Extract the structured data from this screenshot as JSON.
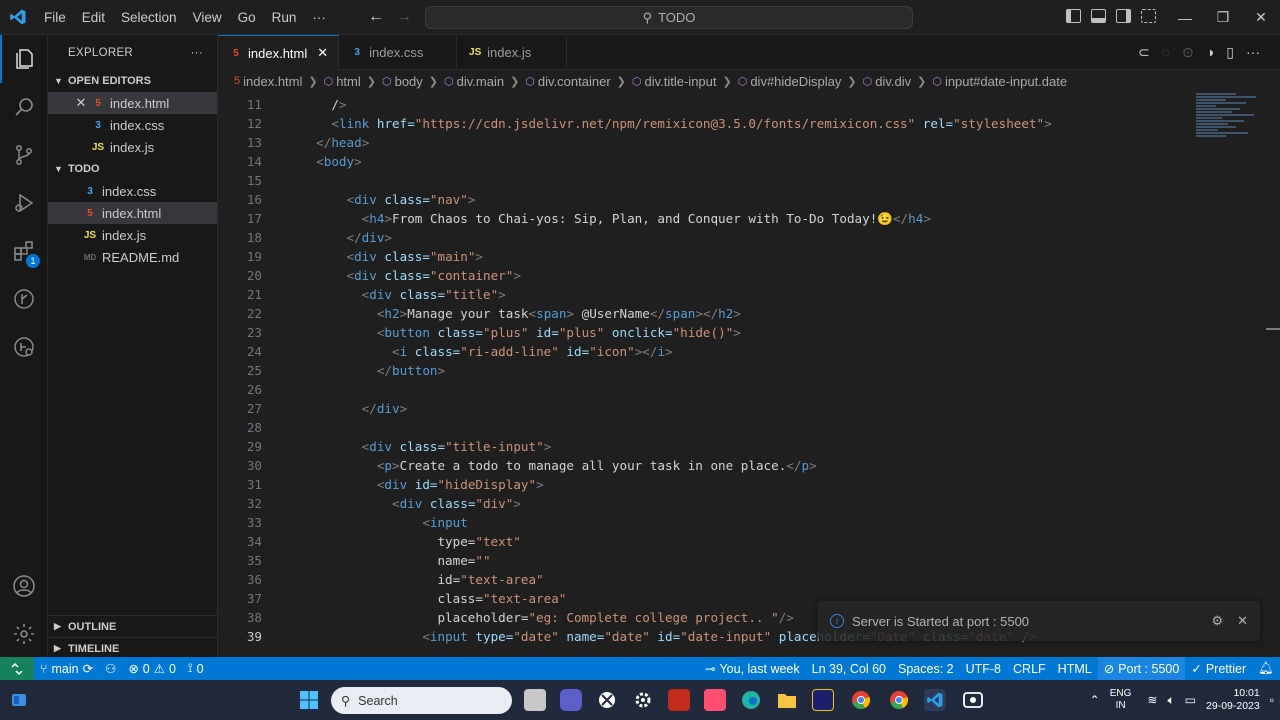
{
  "titlebar": {
    "menu": [
      "File",
      "Edit",
      "Selection",
      "View",
      "Go",
      "Run",
      "···"
    ],
    "search_text": "TODO"
  },
  "sidebar": {
    "title": "EXPLORER",
    "open_editors_label": "OPEN EDITORS",
    "open_editors": [
      {
        "name": "index.html",
        "type": "html"
      },
      {
        "name": "index.css",
        "type": "css"
      },
      {
        "name": "index.js",
        "type": "js"
      }
    ],
    "folder_label": "TODO",
    "files": [
      {
        "name": "index.css",
        "type": "css"
      },
      {
        "name": "index.html",
        "type": "html"
      },
      {
        "name": "index.js",
        "type": "js"
      },
      {
        "name": "README.md",
        "type": "md"
      }
    ],
    "outline_label": "OUTLINE",
    "timeline_label": "TIMELINE"
  },
  "activity": {
    "extensions_badge": "1"
  },
  "tabs": [
    {
      "label": "index.html",
      "type": "html"
    },
    {
      "label": "index.css",
      "type": "css"
    },
    {
      "label": "index.js",
      "type": "js"
    }
  ],
  "breadcrumb": [
    "index.html",
    "html",
    "body",
    "div.main",
    "div.container",
    "div.title-input",
    "div#hideDisplay",
    "div.div",
    "input#date-input.date"
  ],
  "code": {
    "current_line": 39,
    "lines": [
      {
        "n": "11",
        "text": "    />"
      },
      {
        "n": "12",
        "text": "    <link href=\"https://cdn.jsdelivr.net/npm/remixicon@3.5.0/fonts/remixicon.css\" rel=\"stylesheet\">"
      },
      {
        "n": "13",
        "text": "  </head>"
      },
      {
        "n": "14",
        "text": "  <body>"
      },
      {
        "n": "15",
        "text": ""
      },
      {
        "n": "16",
        "text": "      <div class=\"nav\">"
      },
      {
        "n": "17",
        "text": "        <h4>From Chaos to Chai-yos: Sip, Plan, and Conquer with To-Do Today!😉</h4>"
      },
      {
        "n": "18",
        "text": "      </div>"
      },
      {
        "n": "19",
        "text": "      <div class=\"main\">"
      },
      {
        "n": "20",
        "text": "      <div class=\"container\">"
      },
      {
        "n": "21",
        "text": "        <div class=\"title\">"
      },
      {
        "n": "22",
        "text": "          <h2>Manage your task<span> @UserName</span></h2>"
      },
      {
        "n": "23",
        "text": "          <button class=\"plus\" id=\"plus\" onclick=\"hide()\">"
      },
      {
        "n": "24",
        "text": "            <i class=\"ri-add-line\" id=\"icon\"></i>"
      },
      {
        "n": "25",
        "text": "          </button>"
      },
      {
        "n": "26",
        "text": ""
      },
      {
        "n": "27",
        "text": "        </div>"
      },
      {
        "n": "28",
        "text": ""
      },
      {
        "n": "29",
        "text": "        <div class=\"title-input\">"
      },
      {
        "n": "30",
        "text": "          <p>Create a todo to manage all your task in one place.</p>"
      },
      {
        "n": "31",
        "text": "          <div id=\"hideDisplay\">"
      },
      {
        "n": "32",
        "text": "            <div class=\"div\">"
      },
      {
        "n": "33",
        "text": "                <input"
      },
      {
        "n": "34",
        "text": "                  type=\"text\""
      },
      {
        "n": "35",
        "text": "                  name=\"\""
      },
      {
        "n": "36",
        "text": "                  id=\"text-area\""
      },
      {
        "n": "37",
        "text": "                  class=\"text-area\""
      },
      {
        "n": "38",
        "text": "                  placeholder=\"eg: Complete college project.. \"/>"
      },
      {
        "n": "39",
        "text": "                <input type=\"date\" name=\"date\" id=\"date-input\" placeholder=\"Date\" class=\"date\" />"
      }
    ]
  },
  "notification": {
    "message": "Server is Started at port : 5500"
  },
  "statusbar": {
    "branch": "main",
    "errors": "0",
    "warnings": "0",
    "ports": "0",
    "blame": "You, last week",
    "position": "Ln 39, Col 60",
    "spaces": "Spaces: 2",
    "encoding": "UTF-8",
    "eol": "CRLF",
    "language": "HTML",
    "port": "Port : 5500",
    "prettier": "Prettier"
  },
  "taskbar": {
    "search_placeholder": "Search",
    "lang_top": "ENG",
    "lang_bottom": "IN",
    "time": "10:01",
    "date": "29-09-2023"
  }
}
